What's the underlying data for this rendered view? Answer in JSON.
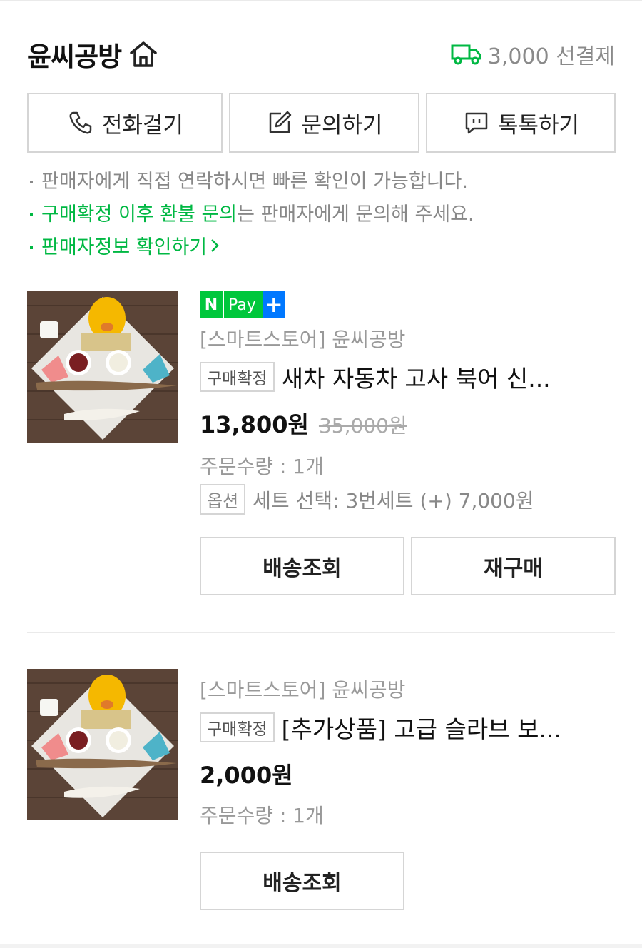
{
  "store": {
    "name": "윤씨공방",
    "shipping": "3,000 선결제",
    "colors": {
      "green": "#00b843",
      "npay_blue": "#0078ff"
    }
  },
  "contact": {
    "call": "전화걸기",
    "inquiry": "문의하기",
    "talktalk": "톡톡하기"
  },
  "notices": {
    "line1": "판매자에게 직접 연락하시면 빠른 확인이 가능합니다.",
    "line2_green": "구매확정 이후 환불 문의",
    "line2_rest": "는 판매자에게 문의해 주세요.",
    "line3": "판매자정보 확인하기"
  },
  "orders": [
    {
      "npay_n": "N",
      "npay_pay": "Pay",
      "npay_plus": "+",
      "seller": "[스마트스토어] 윤씨공방",
      "badge": "구매확정",
      "title": "새차 자동차 고사 북어 신...",
      "price": "13,800원",
      "original_price": "35,000원",
      "quantity": "주문수량 : 1개",
      "option_label": "옵션",
      "option_value": "세트 선택: 3번세트 (+) 7,000원",
      "actions": [
        "배송조회",
        "재구매"
      ]
    },
    {
      "seller": "[스마트스토어] 윤씨공방",
      "badge": "구매확정",
      "title": "[추가상품] 고급 슬라브 보...",
      "price": "2,000원",
      "quantity": "주문수량 : 1개",
      "actions": [
        "배송조회"
      ]
    }
  ]
}
